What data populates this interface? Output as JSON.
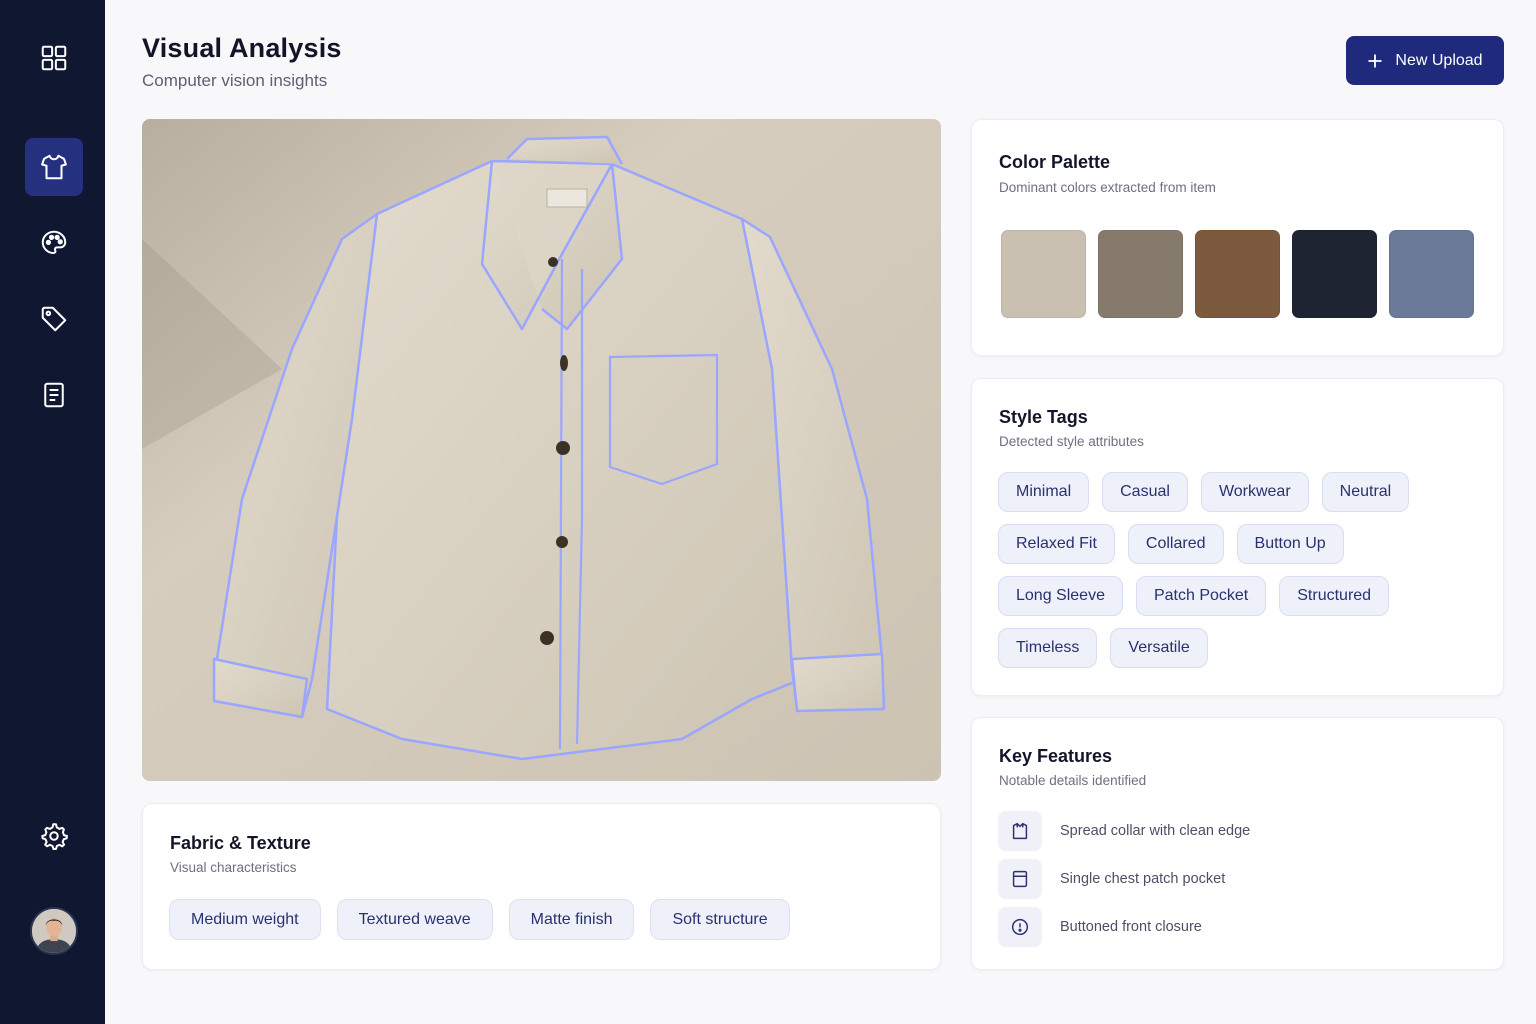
{
  "header": {
    "title": "Visual Analysis",
    "subtitle": "Computer vision insights",
    "upload_label": "New Upload"
  },
  "sidebar": {
    "items": [
      {
        "icon": "grid-icon",
        "active": false
      },
      {
        "icon": "shirt-icon",
        "active": true
      },
      {
        "icon": "palette-icon",
        "active": false
      },
      {
        "icon": "tag-icon",
        "active": false
      },
      {
        "icon": "document-icon",
        "active": false
      },
      {
        "icon": "gear-icon",
        "active": false
      }
    ],
    "avatar": "user-avatar"
  },
  "fabric": {
    "title": "Fabric & Texture",
    "subtitle": "Visual characteristics",
    "chips": [
      "Medium weight",
      "Textured weave",
      "Matte finish",
      "Soft structure"
    ]
  },
  "palette": {
    "title": "Color Palette",
    "subtitle": "Dominant colors extracted from item",
    "swatches": [
      "#c9c0b2",
      "#857a6c",
      "#7b5a3d",
      "#1f2433",
      "#6a7a98"
    ]
  },
  "style_tags": {
    "title": "Style Tags",
    "subtitle": "Detected style attributes",
    "tags": [
      "Minimal",
      "Casual",
      "Workwear",
      "Neutral",
      "Relaxed Fit",
      "Collared",
      "Button Up",
      "Long Sleeve",
      "Patch Pocket",
      "Structured",
      "Timeless",
      "Versatile"
    ]
  },
  "features": {
    "title": "Key Features",
    "subtitle": "Notable details identified",
    "items": [
      {
        "icon": "collar-icon",
        "text": "Spread collar with clean edge"
      },
      {
        "icon": "pocket-icon",
        "text": "Single chest patch pocket"
      },
      {
        "icon": "button-icon",
        "text": "Buttoned front closure"
      }
    ]
  },
  "colors": {
    "sidebar": "#0f1731",
    "accent": "#1f2a7c",
    "outline": "#9aa6ff"
  }
}
